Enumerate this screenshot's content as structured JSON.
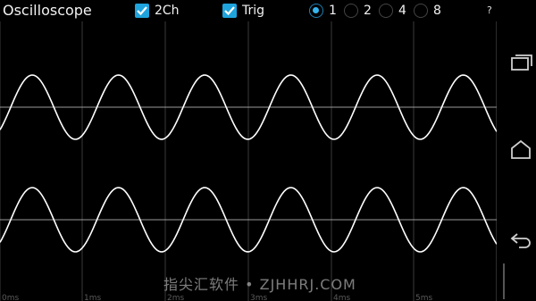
{
  "app": {
    "title": "Oscilloscope"
  },
  "toolbar": {
    "two_channel": {
      "label": "2Ch",
      "checked": true
    },
    "trigger": {
      "label": "Trig",
      "checked": true
    },
    "timebase_options": [
      "1",
      "2",
      "4",
      "8"
    ],
    "timebase_selected": "1",
    "help_label": "?"
  },
  "scope": {
    "time_labels": [
      "0ms",
      "1ms",
      "2ms",
      "3ms",
      "4ms",
      "5ms"
    ],
    "trace_color": "#ffffff",
    "grid_color": "#3a3a3a",
    "baseline_color": "#9a9a9a"
  },
  "navbar": {
    "icons": [
      "recent-apps-icon",
      "home-icon",
      "back-icon"
    ]
  },
  "watermark": {
    "text": "指尖汇软件 • ZJHHRJ.COM"
  }
}
